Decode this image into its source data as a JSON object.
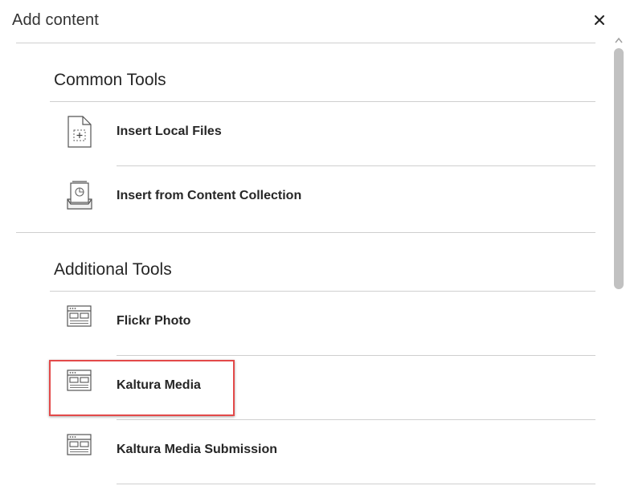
{
  "dialog": {
    "title": "Add content",
    "close_label": "×"
  },
  "sections": [
    {
      "heading": "Common Tools",
      "items": [
        {
          "label": "Insert Local Files",
          "icon": "file-add-icon"
        },
        {
          "label": "Insert from Content Collection",
          "icon": "content-collection-icon"
        }
      ]
    },
    {
      "heading": "Additional Tools",
      "items": [
        {
          "label": "Flickr Photo",
          "icon": "browser-window-icon"
        },
        {
          "label": "Kaltura Media",
          "icon": "browser-window-icon"
        },
        {
          "label": "Kaltura Media Submission",
          "icon": "browser-window-icon"
        }
      ]
    }
  ],
  "colors": {
    "highlight": "#e34a4a",
    "divider": "#cfcfcf",
    "scrollbar_thumb": "#c1c1c1"
  }
}
